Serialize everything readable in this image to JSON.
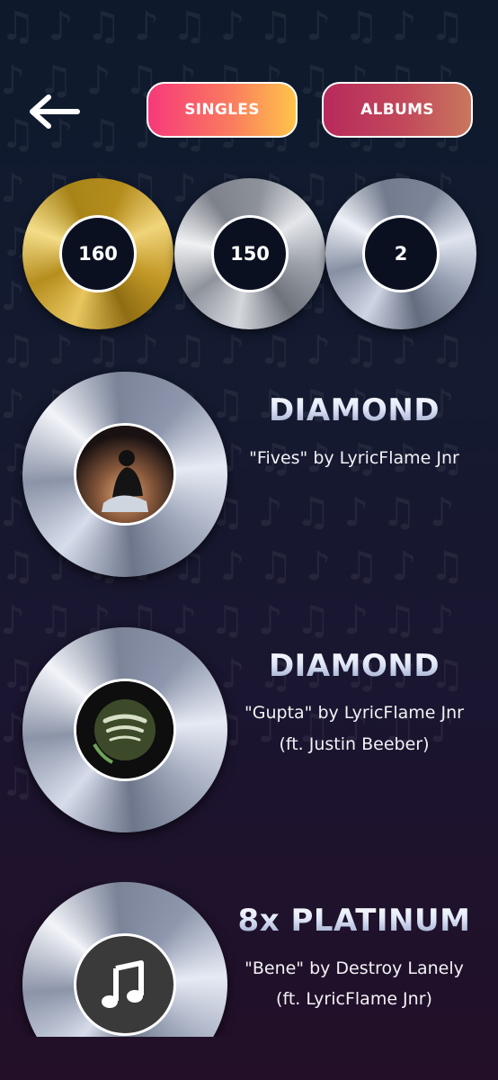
{
  "nav": {
    "back_icon": "arrow-left-icon",
    "tabs": [
      {
        "label": "SINGLES",
        "active": true
      },
      {
        "label": "ALBUMS",
        "active": false
      }
    ]
  },
  "stats": [
    {
      "value": "160",
      "tier": "gold"
    },
    {
      "value": "150",
      "tier": "silver"
    },
    {
      "value": "2",
      "tier": "platinum"
    }
  ],
  "records": [
    {
      "certification": "DIAMOND",
      "line1": "\"Fives\" by LyricFlame Jnr",
      "line2": ""
    },
    {
      "certification": "DIAMOND",
      "line1": "\"Gupta\" by LyricFlame Jnr",
      "line2": "(ft. Justin Beeber)"
    },
    {
      "certification": "8x PLATINUM",
      "line1": "\"Bene\" by Destroy Lanely",
      "line2": "(ft. LyricFlame Jnr)"
    }
  ],
  "colors": {
    "singles_gradient": [
      "#f7397a",
      "#ffc44a"
    ],
    "albums_gradient": [
      "#b82a5c",
      "#c9775c"
    ],
    "background": "#141a30"
  }
}
